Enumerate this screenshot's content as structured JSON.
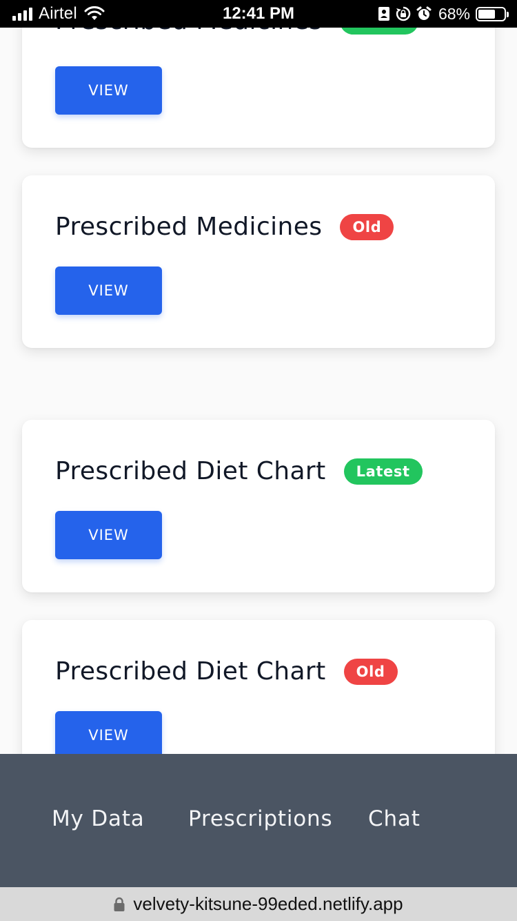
{
  "status_bar": {
    "carrier": "Airtel",
    "time": "12:41 PM",
    "battery_percent": "68%",
    "battery_level": 0.68,
    "icons": [
      "signal-icon",
      "wifi-icon",
      "portrait-lock-icon",
      "orientation-lock-icon",
      "alarm-icon",
      "battery-icon"
    ]
  },
  "cards": [
    {
      "title": "Prescribed Medicines",
      "badge": "Latest",
      "button": "VIEW"
    },
    {
      "title": "Prescribed Medicines",
      "badge": "Old",
      "button": "VIEW"
    },
    {
      "title": "Prescribed Diet Chart",
      "badge": "Latest",
      "button": "VIEW"
    },
    {
      "title": "Prescribed Diet Chart",
      "badge": "Old",
      "button": "VIEW"
    }
  ],
  "bottom_nav": {
    "items": [
      "My Data",
      "Prescriptions",
      "Chat"
    ]
  },
  "url_bar": {
    "url": "velvety-kitsune-99eded.netlify.app"
  },
  "colors": {
    "accent_button": "#2563eb",
    "badge_latest": "#22c55e",
    "badge_old": "#ef4444",
    "nav_background": "#4b5563"
  }
}
